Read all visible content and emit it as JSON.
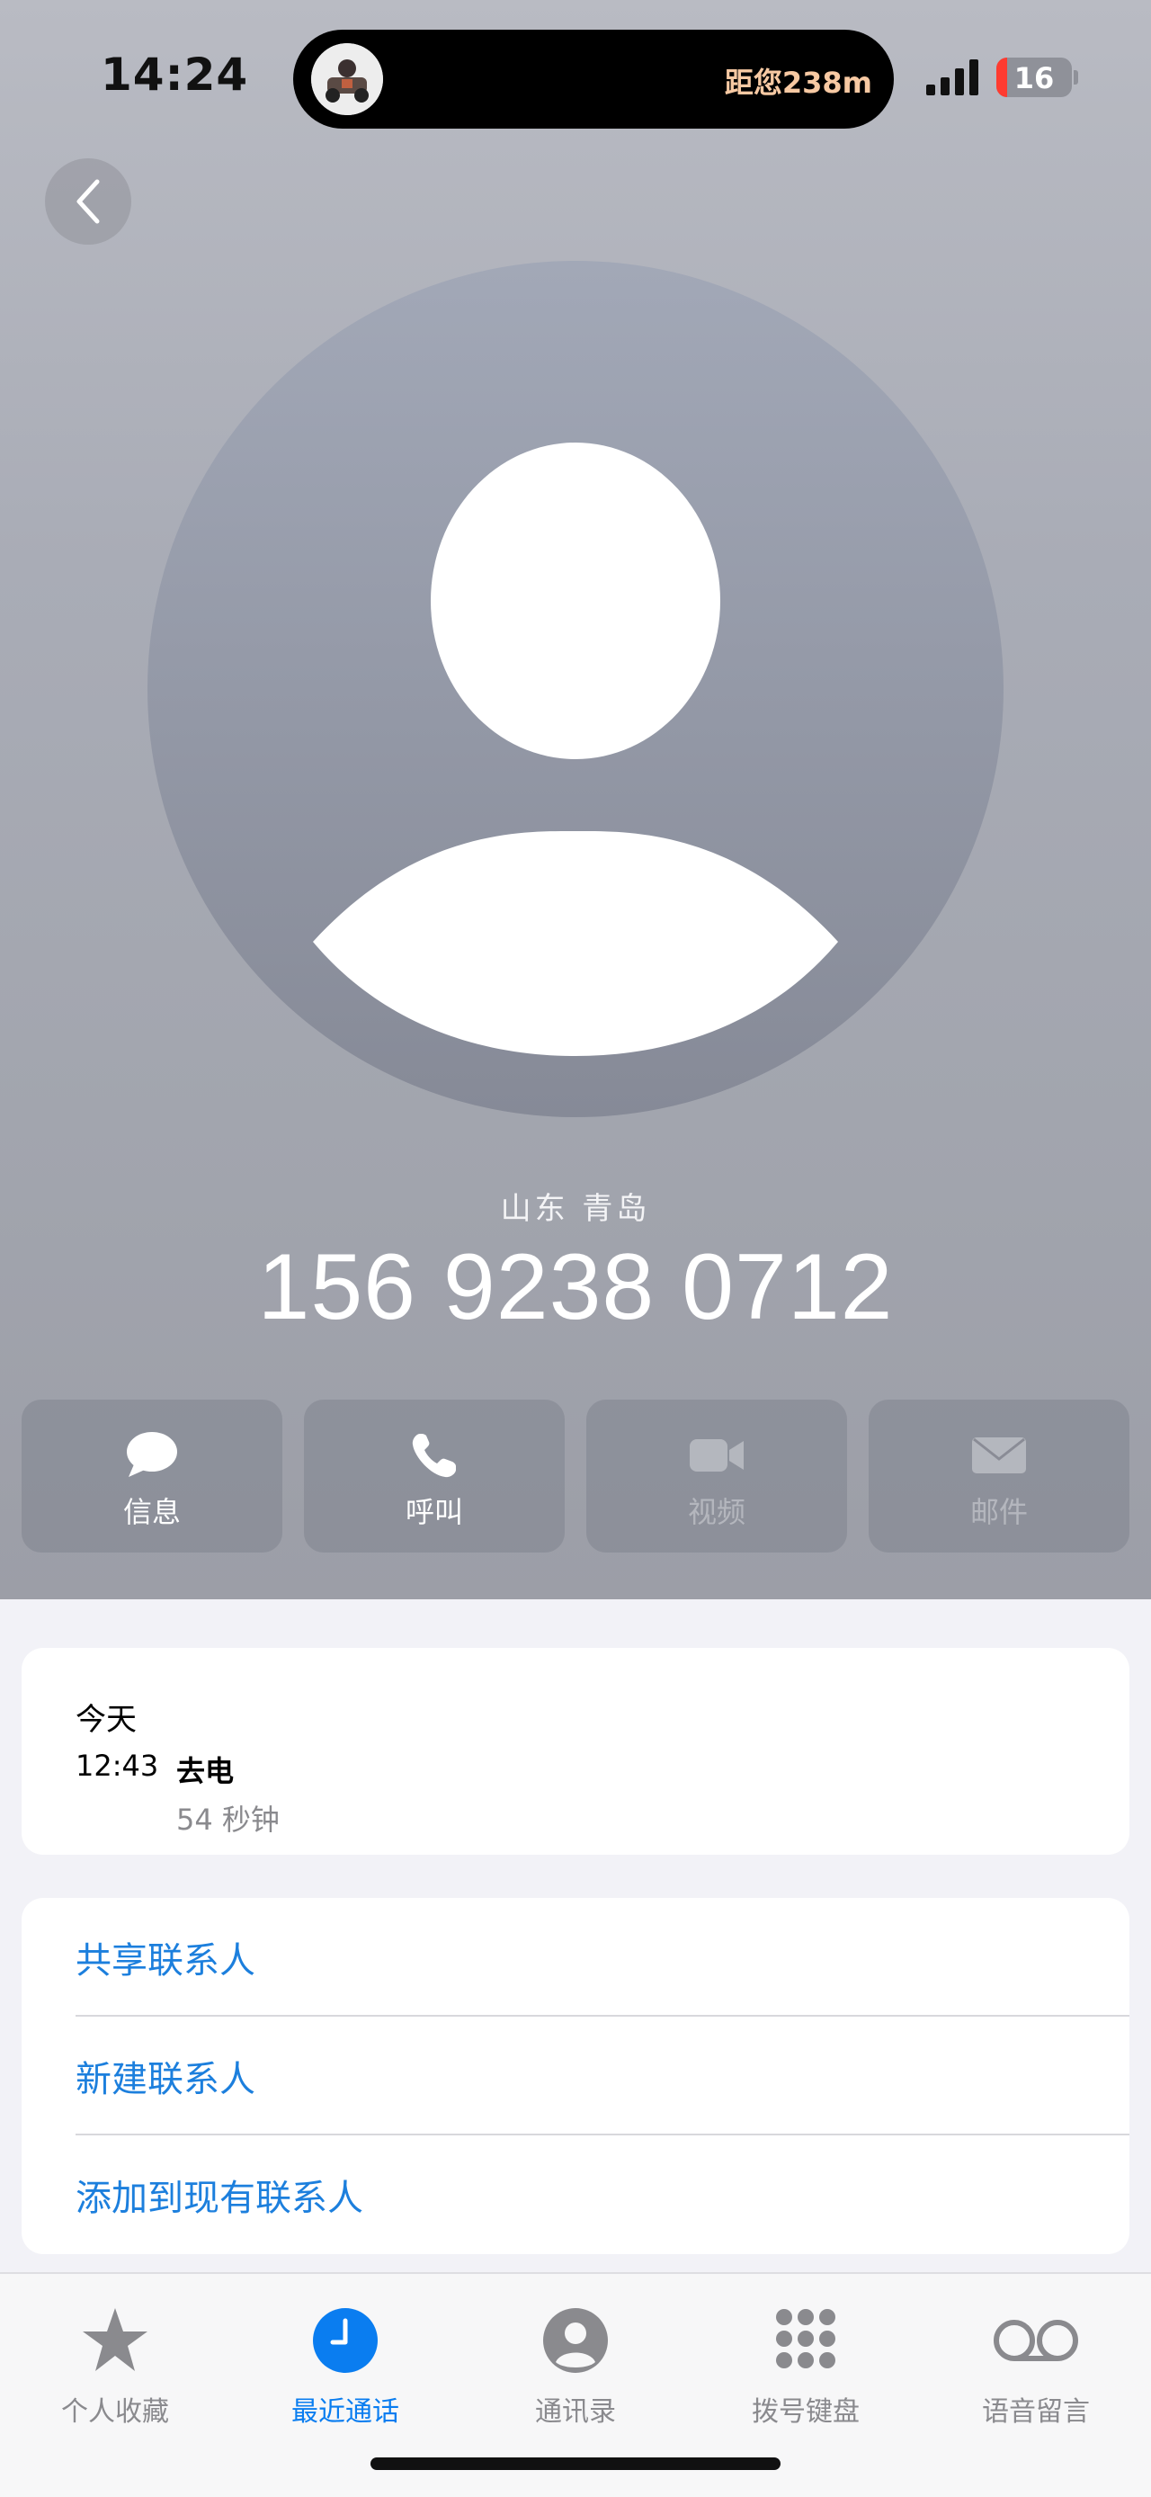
{
  "status_bar": {
    "time": "14:24",
    "island_text": "距您238m",
    "battery": "16"
  },
  "contact": {
    "location": "山东 青岛",
    "phone": "156 9238 0712"
  },
  "actions": [
    {
      "label": "信息",
      "icon": "message-icon",
      "enabled": true
    },
    {
      "label": "呼叫",
      "icon": "phone-icon",
      "enabled": true
    },
    {
      "label": "视频",
      "icon": "video-icon",
      "enabled": false
    },
    {
      "label": "邮件",
      "icon": "mail-icon",
      "enabled": false
    }
  ],
  "recent": {
    "day": "今天",
    "time": "12:43",
    "type": "去电",
    "duration": "54 秒钟"
  },
  "links": [
    "共享联系人",
    "新建联系人",
    "添加到现有联系人"
  ],
  "tabs": [
    {
      "label": "个人收藏",
      "icon": "star-icon",
      "active": false
    },
    {
      "label": "最近通话",
      "icon": "clock-icon",
      "active": true
    },
    {
      "label": "通讯录",
      "icon": "person-icon",
      "active": false
    },
    {
      "label": "拨号键盘",
      "icon": "keypad-icon",
      "active": false
    },
    {
      "label": "语音留言",
      "icon": "voicemail-icon",
      "active": false
    }
  ],
  "colors": {
    "link": "#1c7fdd",
    "active_tab": "#0a7df0",
    "battery_low": "#ff3b30"
  }
}
